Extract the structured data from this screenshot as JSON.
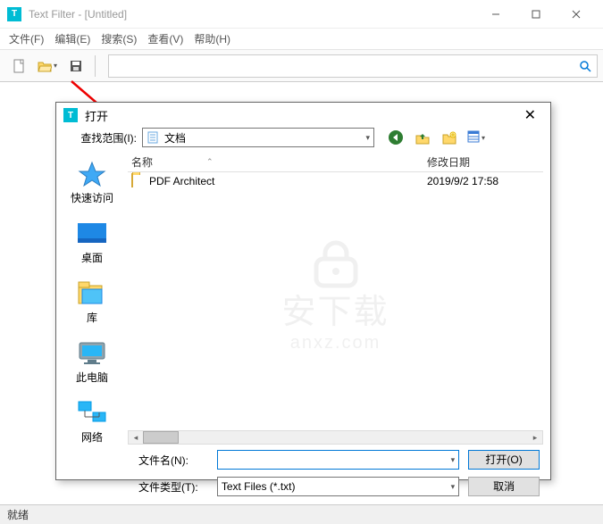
{
  "window": {
    "title": "Text Filter - [Untitled]"
  },
  "menu": {
    "file": "文件(F)",
    "edit": "编辑(E)",
    "search": "搜索(S)",
    "view": "查看(V)",
    "help": "帮助(H)"
  },
  "toolbar": {
    "search_placeholder": ""
  },
  "statusbar": {
    "text": "就绪"
  },
  "dialog": {
    "title": "打开",
    "lookin_label": "查找范围(I):",
    "lookin_value": "文档",
    "columns": {
      "name": "名称",
      "date": "修改日期"
    },
    "rows": [
      {
        "name": "PDF Architect",
        "date": "2019/9/2 17:58"
      }
    ],
    "places": {
      "quick": "快速访问",
      "desktop": "桌面",
      "libraries": "库",
      "thispc": "此电脑",
      "network": "网络"
    },
    "filename_label": "文件名(N):",
    "filename_value": "",
    "filetype_label": "文件类型(T):",
    "filetype_value": "Text Files (*.txt)",
    "open_btn": "打开(O)",
    "cancel_btn": "取消"
  },
  "watermark": {
    "line1": "安下载",
    "line2": "anxz.com"
  }
}
